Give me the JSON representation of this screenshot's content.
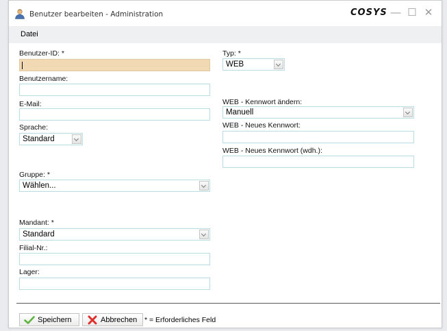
{
  "window": {
    "title": "Benutzer bearbeiten - Administration",
    "brand": "COSYS",
    "controls": {
      "minimize": "—",
      "maximize": "☐",
      "close": "✕"
    }
  },
  "menu": {
    "items": [
      {
        "label": "Datei"
      }
    ]
  },
  "form": {
    "benutzer_id": {
      "label": "Benutzer-ID: *",
      "value": ""
    },
    "benutzername": {
      "label": "Benutzername:",
      "value": ""
    },
    "email": {
      "label": "E-Mail:",
      "value": ""
    },
    "sprache": {
      "label": "Sprache:",
      "value": "Standard"
    },
    "gruppe": {
      "label": "Gruppe: *",
      "value": "Wählen..."
    },
    "mandant": {
      "label": "Mandant: *",
      "value": "Standard"
    },
    "filial_nr": {
      "label": "Filial-Nr.:",
      "value": ""
    },
    "lager": {
      "label": "Lager:",
      "value": ""
    },
    "typ": {
      "label": "Typ: *",
      "value": "WEB"
    },
    "web_kennwort_aendern": {
      "label": "WEB - Kennwort ändern:",
      "value": "Manuell"
    },
    "web_neues_kennwort": {
      "label": "WEB - Neues Kennwort:",
      "value": ""
    },
    "web_neues_kennwort_wdh": {
      "label": "WEB - Neues Kennwort (wdh.):",
      "value": ""
    }
  },
  "footer": {
    "save_label": "Speichern",
    "cancel_label": "Abbrechen",
    "required_note": "* = Erforderliches Feld"
  },
  "icons": {
    "title": "user-icon",
    "save": "check-icon",
    "cancel": "cross-icon"
  },
  "colors": {
    "focused_field": "#f1d9b4",
    "field_border": "#b8dde4",
    "menubar": "#eef0f2",
    "check_green": "#5db33c",
    "cross_red": "#e0302b"
  }
}
